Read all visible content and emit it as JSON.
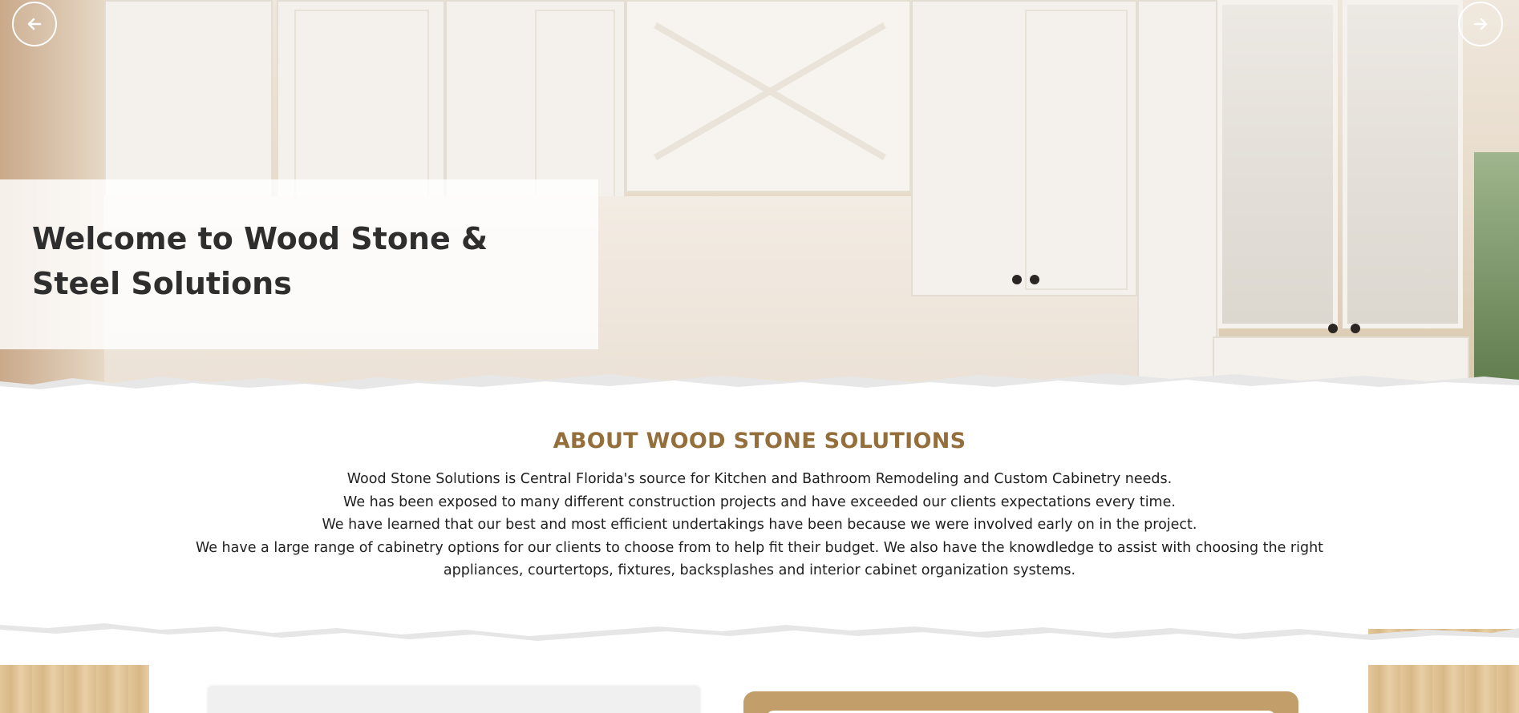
{
  "hero": {
    "title": "Welcome to Wood Stone & Steel Solutions",
    "prev_icon": "arrow-left-icon",
    "next_icon": "arrow-right-icon"
  },
  "about": {
    "heading": "ABOUT WOOD STONE SOLUTIONS",
    "paragraphs": [
      "Wood Stone Solutions is Central Florida's source for Kitchen and Bathroom Remodeling and Custom Cabinetry needs.",
      "We has been exposed to many different construction projects and have exceeded our clients expectations every time.",
      "We have learned that our best and most efficient undertakings have been because we were involved early on in the project.",
      "We have a large range of cabinetry options for our clients to choose from to help fit their budget. We also have the knowdledge to assist with choosing the right appliances, courtertops, fixtures, backsplashes and interior cabinet organization systems."
    ]
  },
  "colors": {
    "heading": "#956f3b",
    "card_accent": "#c19e6a",
    "text": "#1f1f1f"
  }
}
